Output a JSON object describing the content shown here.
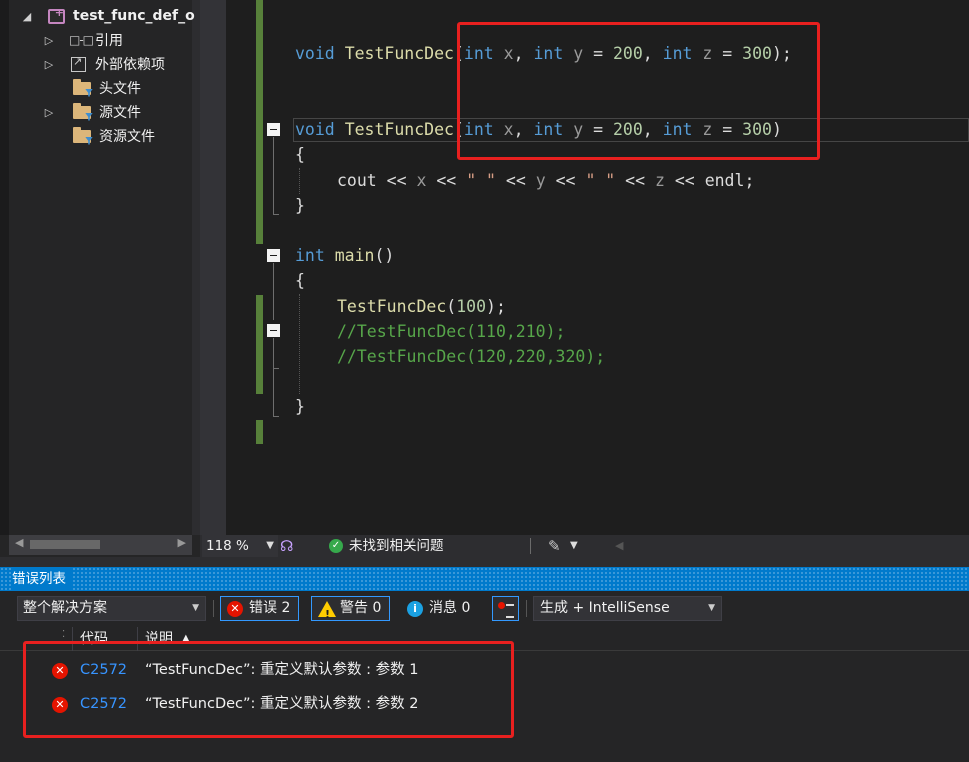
{
  "solution_explorer": {
    "project": "test_func_def_o",
    "items": [
      {
        "label": "引用",
        "icon": "references-icon",
        "expandable": true
      },
      {
        "label": "外部依赖项",
        "icon": "external-deps-icon",
        "expandable": true
      },
      {
        "label": "头文件",
        "icon": "folder-filter-icon",
        "expandable": false
      },
      {
        "label": "源文件",
        "icon": "folder-filter-icon",
        "expandable": true
      },
      {
        "label": "资源文件",
        "icon": "folder-filter-icon",
        "expandable": false
      }
    ]
  },
  "editor": {
    "lines": [
      "void TestFuncDec(int x, int y = 200, int z = 300);",
      "void TestFuncDec(int x, int y = 200, int z = 300)",
      "{",
      "cout << x << \" \" << y << \" \" << z << endl;",
      "}",
      "int main()",
      "{",
      "TestFuncDec(100);",
      "//TestFuncDec(110,210);",
      "//TestFuncDec(120,220,320);",
      "}"
    ],
    "colors": {
      "keyword": "#569cd6",
      "function": "#dcdcaa",
      "number": "#b5cea8",
      "comment": "#57a64a",
      "string": "#d69d85",
      "change_bar": "#57803a"
    }
  },
  "status_strip": {
    "zoom": "118 %",
    "status_text": "未找到相关问题"
  },
  "error_list": {
    "title": "错误列表",
    "scope": "整个解决方案",
    "errors_filter": "错误 2",
    "warnings_filter": "警告 0",
    "messages_filter": "消息 0",
    "source": "生成 + IntelliSense",
    "columns": {
      "code": "代码",
      "description": "说明"
    },
    "rows": [
      {
        "code": "C2572",
        "description": "“TestFuncDec”: 重定义默认参数 : 参数 1"
      },
      {
        "code": "C2572",
        "description": "“TestFuncDec”: 重定义默认参数 : 参数 2"
      }
    ],
    "accent_color": "#007acc",
    "error_color": "#e51400"
  },
  "annotation_color": "#e8201f"
}
